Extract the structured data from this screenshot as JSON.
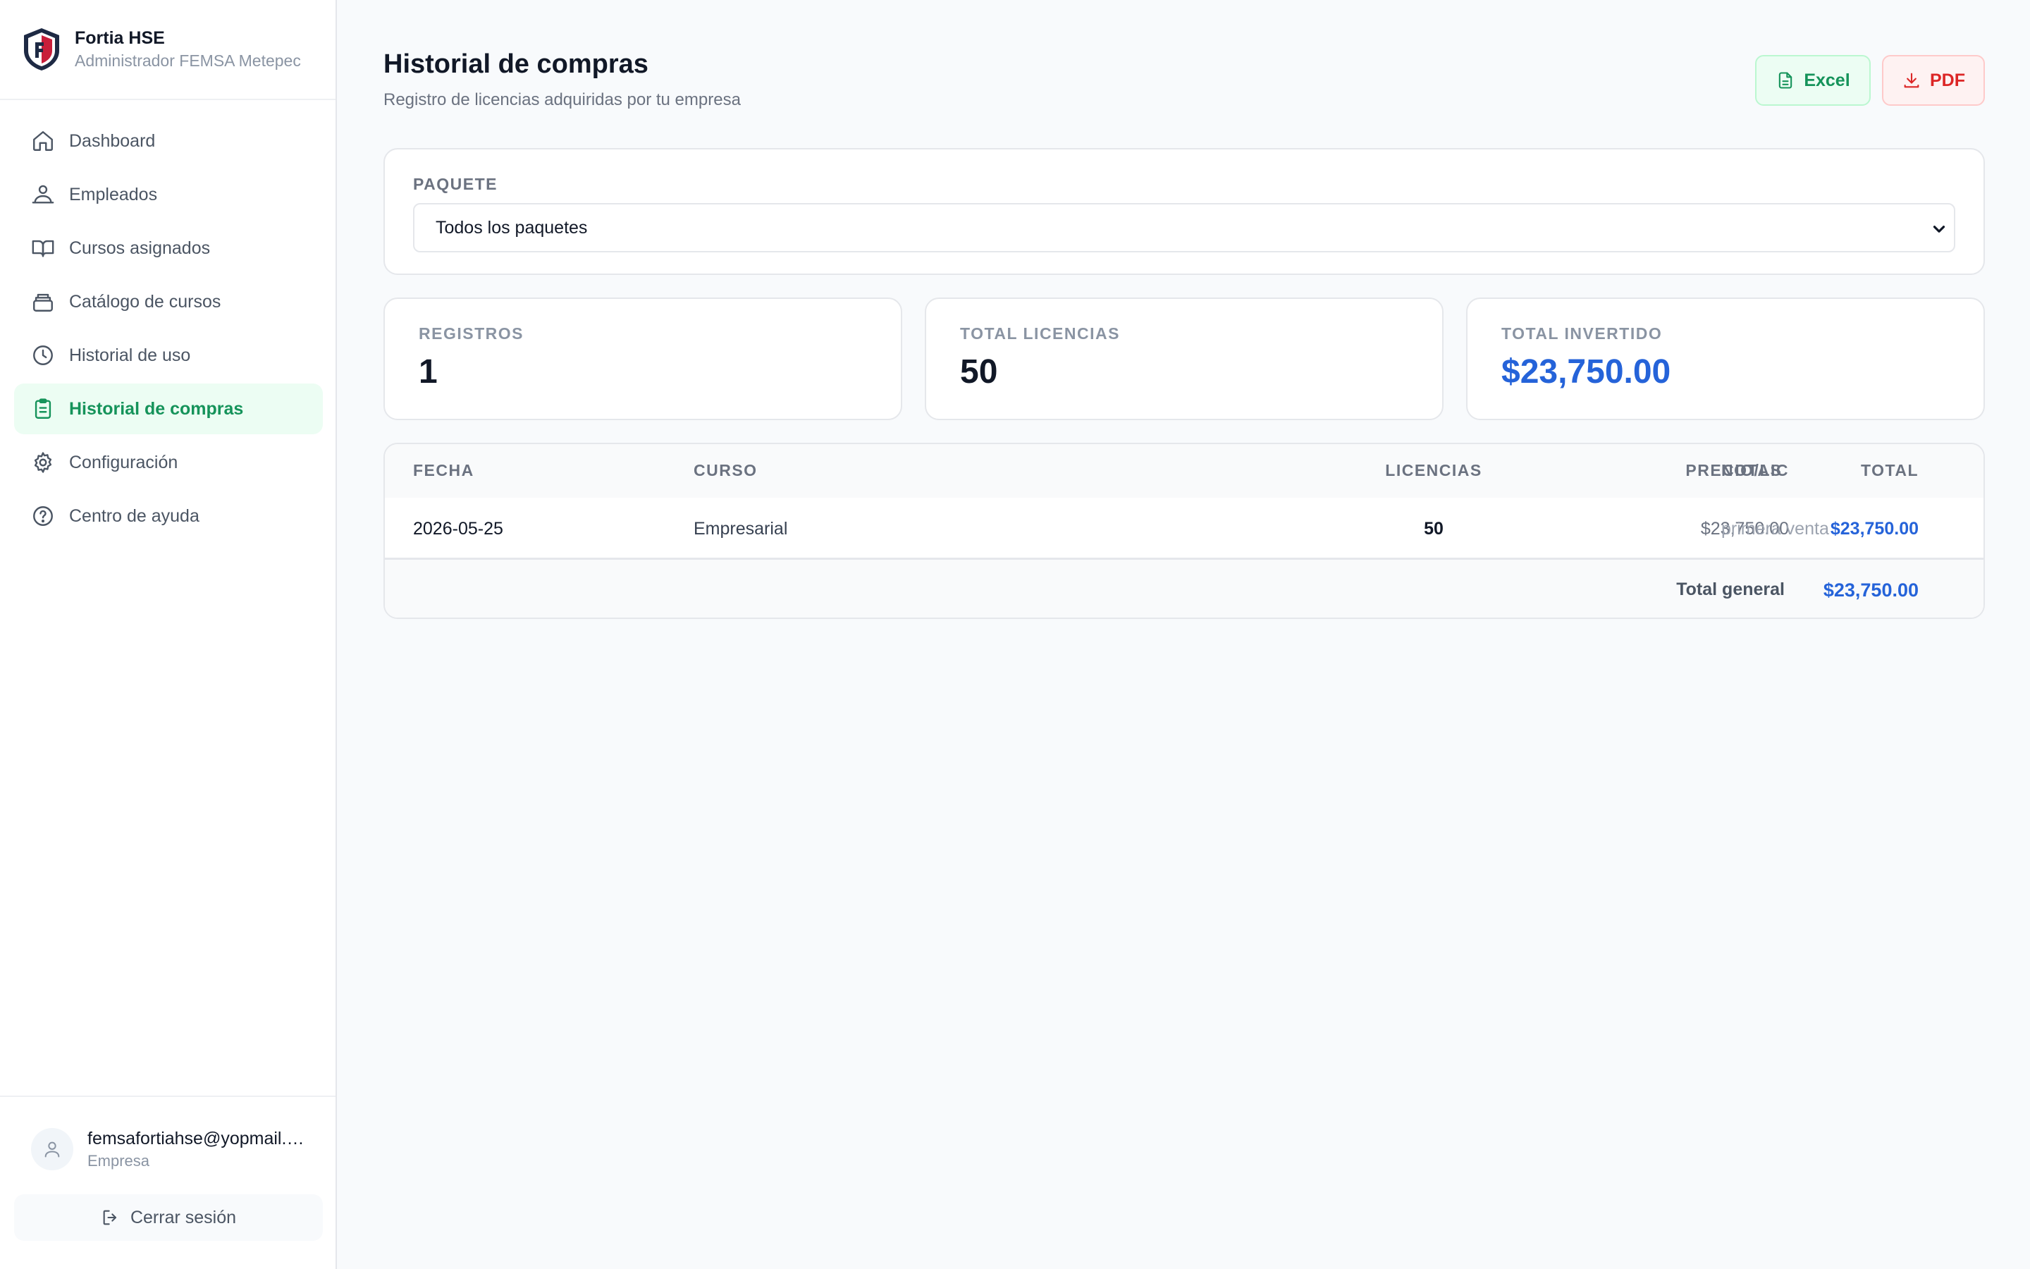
{
  "brand": {
    "name": "Fortia HSE",
    "subtitle": "Administrador FEMSA Metepec"
  },
  "nav": {
    "items": [
      {
        "label": "Dashboard",
        "icon": "home-icon"
      },
      {
        "label": "Empleados",
        "icon": "users-icon"
      },
      {
        "label": "Cursos asignados",
        "icon": "book-icon"
      },
      {
        "label": "Catálogo de cursos",
        "icon": "layers-icon"
      },
      {
        "label": "Historial de uso",
        "icon": "clock-icon"
      },
      {
        "label": "Historial de compras",
        "icon": "clipboard-icon",
        "active": true
      },
      {
        "label": "Configuración",
        "icon": "gear-icon"
      },
      {
        "label": "Centro de ayuda",
        "icon": "help-icon"
      }
    ]
  },
  "user": {
    "email": "femsafortiahse@yopmail.com",
    "role": "Empresa"
  },
  "logout_label": "Cerrar sesión",
  "page": {
    "title": "Historial de compras",
    "subtitle": "Registro de licencias adquiridas por tu empresa"
  },
  "actions": {
    "excel": "Excel",
    "pdf": "PDF"
  },
  "filter": {
    "label": "PAQUETE",
    "selected": "Todos los paquetes"
  },
  "stats": {
    "registros": {
      "label": "REGISTROS",
      "value": "1"
    },
    "licencias": {
      "label": "TOTAL LICENCIAS",
      "value": "50"
    },
    "invertido": {
      "label": "TOTAL INVERTIDO",
      "value": "$23,750.00"
    }
  },
  "table": {
    "headers": [
      "FECHA",
      "CURSO",
      "LICENCIAS",
      "PRECIO/LIC",
      "TOTAL",
      "NOTAS"
    ],
    "rows": [
      {
        "fecha": "2026-05-25",
        "curso": "Empresarial",
        "licencias": "50",
        "precio": "$23,750.00",
        "total": "$23,750.00",
        "notas": "primera venta"
      }
    ],
    "footer": {
      "label": "Total general",
      "total": "$23,750.00"
    }
  },
  "colors": {
    "accent_green": "#15935a",
    "accent_blue": "#2563d9",
    "danger_red": "#dc2626"
  }
}
